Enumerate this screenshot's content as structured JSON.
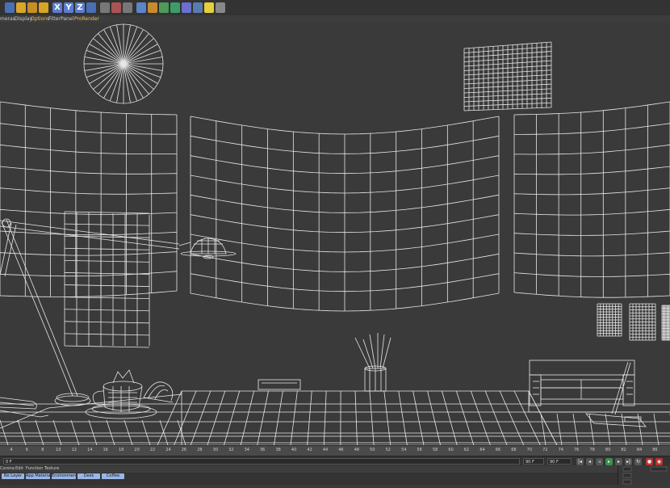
{
  "toolbar": {
    "axis_buttons": [
      "X",
      "Y",
      "Z"
    ]
  },
  "menubar": {
    "items": [
      "meras",
      "Display",
      "Options",
      "Filter",
      "Panel",
      "ProRender"
    ],
    "active_index": 2
  },
  "timeline": {
    "ticks": [
      "4",
      "6",
      "8",
      "10",
      "12",
      "14",
      "16",
      "18",
      "20",
      "22",
      "24",
      "26",
      "28",
      "30",
      "32",
      "34",
      "36",
      "38",
      "40",
      "42",
      "44",
      "46",
      "48",
      "50",
      "52",
      "54",
      "56",
      "58",
      "60",
      "62",
      "64",
      "66",
      "68",
      "70",
      "72",
      "74",
      "76",
      "78",
      "80",
      "82",
      "84",
      "86"
    ]
  },
  "transport": {
    "start_frame": "0 F",
    "end_frame": "90 F",
    "end_frame_left": "90 F"
  },
  "material_menu": {
    "items": [
      "Corona",
      "Edit",
      "Function",
      "Texture"
    ]
  },
  "layers": {
    "tabs": [
      "No Layer",
      "App Materials",
      "Environment",
      "Desk",
      "Coffee"
    ]
  },
  "colors": {
    "viewport_bg": "#3a3a3a",
    "wire": "#e8e8e8",
    "accent": "#e9c24b",
    "layer_tab": "#9ab6e6"
  }
}
